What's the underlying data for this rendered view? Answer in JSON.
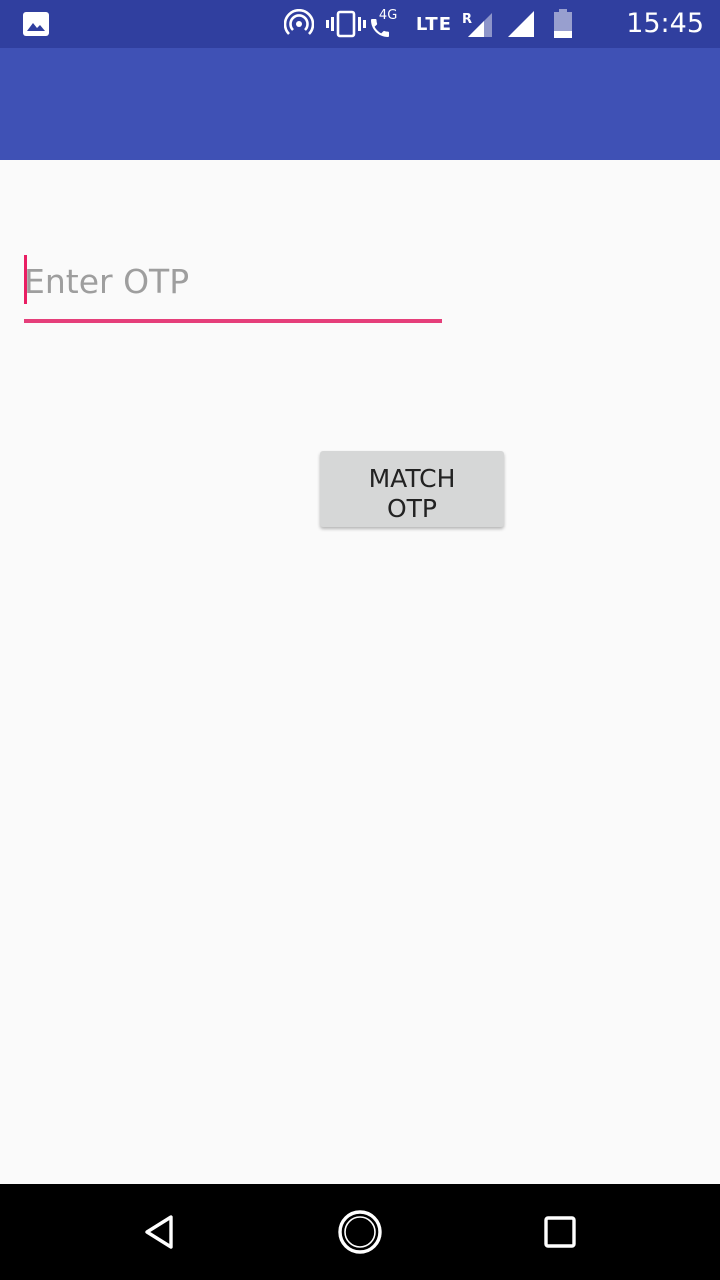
{
  "status_bar": {
    "time": "15:45",
    "network_4g": "4G",
    "network_lte": "LTE",
    "roaming": "R",
    "icons": [
      "gallery-icon",
      "hotspot-icon",
      "vibrate-icon",
      "call-icon",
      "signal-icon",
      "signal-icon",
      "battery-icon"
    ],
    "background_color": "#303f9f"
  },
  "app_bar": {
    "background_color": "#3f51b5"
  },
  "otp_input": {
    "placeholder": "Enter OTP",
    "value": "",
    "accent_color": "#e91e63"
  },
  "match_button": {
    "label": "MATCH OTP"
  },
  "nav_bar": {
    "icons": [
      "back-icon",
      "home-icon",
      "recents-icon"
    ]
  }
}
